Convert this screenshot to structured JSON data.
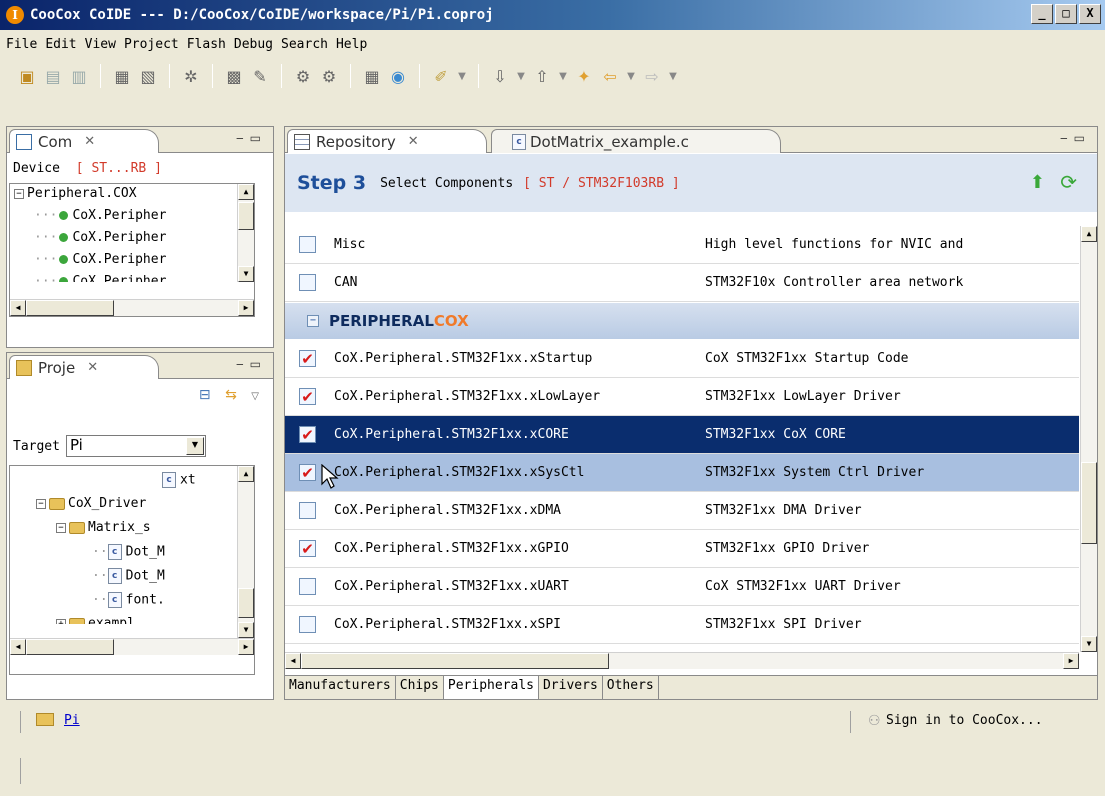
{
  "window": {
    "title": "CooCox CoIDE --- D:/CooCox/CoIDE/workspace/Pi/Pi.coproj",
    "buttons": [
      "_",
      "□",
      "X"
    ]
  },
  "menu": [
    "File",
    "Edit",
    "View",
    "Project",
    "Flash",
    "Debug",
    "Search",
    "Help"
  ],
  "toolbar_icons": [
    "new-file-icon",
    "new-project-icon",
    "save-icon",
    "build-icon",
    "rebuild-icon",
    "config-icon",
    "repository-icon",
    "flash-icon",
    "debug-icon",
    "debug-step-icon",
    "component-icon",
    "peripheral-icon",
    "link-icon",
    "next-annotation-icon",
    "previous-annotation-icon",
    "last-edit-icon",
    "back-icon",
    "forward-icon"
  ],
  "components_view": {
    "tab_label": "Com",
    "device_label": "Device",
    "device_value": "[ ST...RB ]",
    "tree": {
      "root": "Peripheral.COX",
      "items": [
        "CoX.Peripher",
        "CoX.Peripher",
        "CoX.Peripher",
        "CoX.Peripher"
      ]
    }
  },
  "project_view": {
    "tab_label": "Proje",
    "target_label": "Target",
    "target_value": "Pi",
    "tree": {
      "file_top": "xt",
      "folder1": "CoX_Driver",
      "folder2": "Matrix_s",
      "file1": "Dot_M",
      "file2": "Dot_M",
      "file3": "font.",
      "folder3": "exampl"
    }
  },
  "editor": {
    "tabs": [
      {
        "label": "Repository",
        "active": true
      },
      {
        "label": "DotMatrix_example.c",
        "active": false
      }
    ],
    "step": {
      "label": "Step 3",
      "title": "Select Components",
      "chip": "[ ST / STM32F103RB ]"
    },
    "rows_top": [
      {
        "name": "Misc",
        "desc": "High level functions for NVIC and",
        "checked": false
      },
      {
        "name": "CAN",
        "desc": "STM32F10x Controller area network",
        "checked": false
      }
    ],
    "group": {
      "part1": "PERIPHERAL",
      "part2": "COX",
      "toggle": "−"
    },
    "rows": [
      {
        "name": "CoX.Peripheral.STM32F1xx.xStartup",
        "desc": "CoX STM32F1xx Startup Code",
        "checked": true,
        "state": ""
      },
      {
        "name": "CoX.Peripheral.STM32F1xx.xLowLayer",
        "desc": "STM32F1xx LowLayer Driver",
        "checked": true,
        "state": ""
      },
      {
        "name": "CoX.Peripheral.STM32F1xx.xCORE",
        "desc": "STM32F1xx CoX CORE",
        "checked": true,
        "state": "selected"
      },
      {
        "name": "CoX.Peripheral.STM32F1xx.xSysCtl",
        "desc": "STM32F1xx System Ctrl Driver",
        "checked": true,
        "state": "hover"
      },
      {
        "name": "CoX.Peripheral.STM32F1xx.xDMA",
        "desc": "STM32F1xx DMA Driver",
        "checked": false,
        "state": ""
      },
      {
        "name": "CoX.Peripheral.STM32F1xx.xGPIO",
        "desc": "STM32F1xx GPIO Driver",
        "checked": true,
        "state": ""
      },
      {
        "name": "CoX.Peripheral.STM32F1xx.xUART",
        "desc": "CoX STM32F1xx UART Driver",
        "checked": false,
        "state": ""
      },
      {
        "name": "CoX.Peripheral.STM32F1xx.xSPI",
        "desc": "STM32F1xx SPI Driver",
        "checked": false,
        "state": ""
      }
    ],
    "bottom_tabs": [
      "Manufacturers",
      "Chips",
      "Peripherals",
      "Drivers",
      "Others"
    ],
    "active_bottom_tab": "Peripherals"
  },
  "status": {
    "project_link": "Pi",
    "sign_in": "Sign in to CooCox..."
  },
  "colors": {
    "accent": "#1e4f9a",
    "check": "#d81a1a",
    "selection": "#0a2d6e",
    "hover": "#a8bfe0",
    "cox_orange": "#f07a2a"
  }
}
